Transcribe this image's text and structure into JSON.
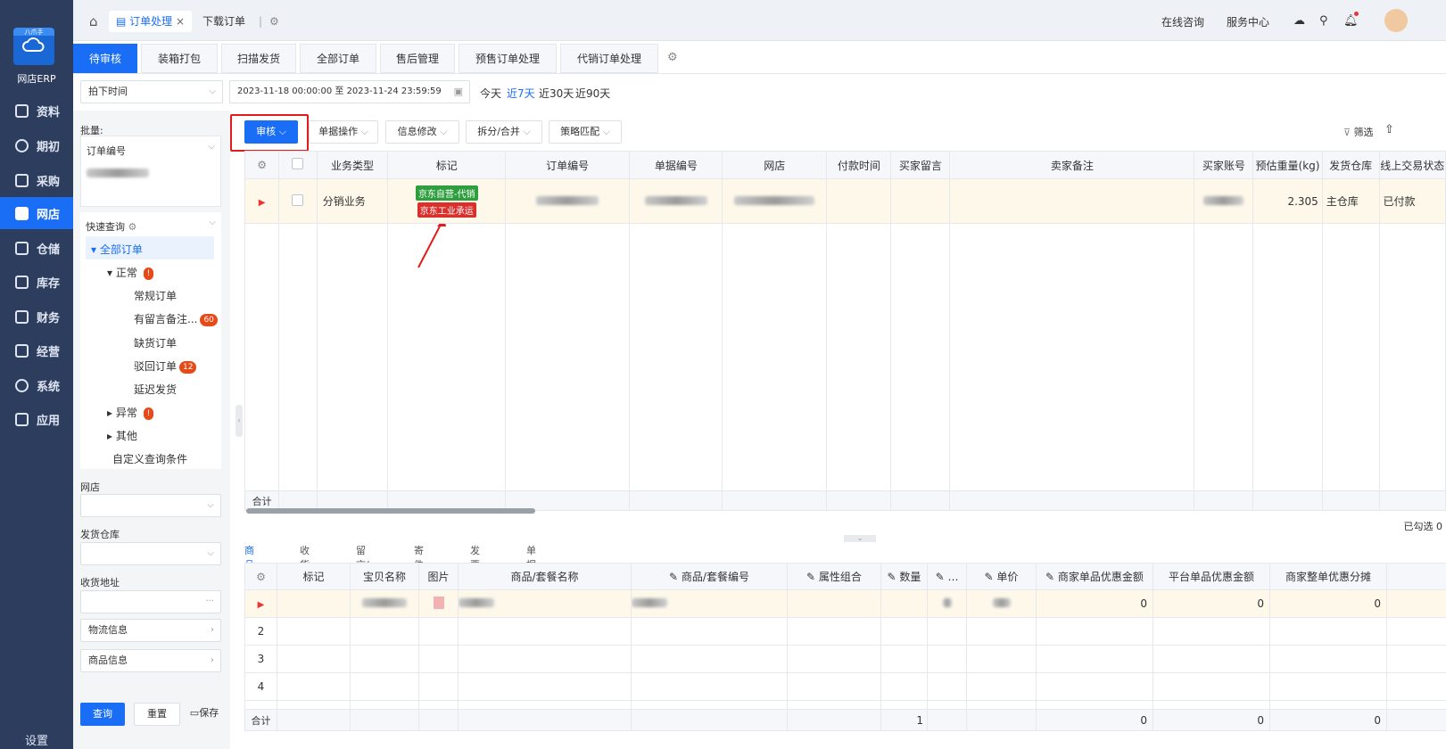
{
  "nav": {
    "logo_badge": "八爪手",
    "brand": "网店ERP",
    "items": [
      {
        "label": "资料",
        "icon": "doc-icon"
      },
      {
        "label": "期初",
        "icon": "target-icon"
      },
      {
        "label": "采购",
        "icon": "cart-icon"
      },
      {
        "label": "网店",
        "icon": "store-icon"
      },
      {
        "label": "仓储",
        "icon": "warehouse-icon"
      },
      {
        "label": "库存",
        "icon": "house-icon"
      },
      {
        "label": "财务",
        "icon": "finance-icon"
      },
      {
        "label": "经营",
        "icon": "chart-icon"
      },
      {
        "label": "系统",
        "icon": "system-icon"
      },
      {
        "label": "应用",
        "icon": "plus-icon"
      }
    ],
    "active_index": 3,
    "settings": "设置"
  },
  "topbar": {
    "tab_active": "订单处理",
    "tab_other": "下载订单",
    "online": "在线咨询",
    "service": "服务中心"
  },
  "tabs": [
    "待审核",
    "装箱打包",
    "扫描发货",
    "全部订单",
    "售后管理",
    "预售订单处理",
    "代销订单处理"
  ],
  "datebar": {
    "time_type": "拍下时间",
    "range": "2023-11-18 00:00:00  至  2023-11-24 23:59:59",
    "today": "今天",
    "d7": "近7天",
    "d30": "近30天",
    "d90": "近90天"
  },
  "left": {
    "batch": "批量:",
    "order_no": "订单编号",
    "quick": "快速查询",
    "all": "全部订单",
    "normal": "正常",
    "regular": "常规订单",
    "remark": "有留言备注...",
    "remark_count": "60",
    "shortage": "缺货订单",
    "rejected": "驳回订单",
    "rejected_count": "12",
    "delayed": "延迟发货",
    "abnormal": "异常",
    "other": "其他",
    "custom": "自定义查询条件",
    "shop": "网店",
    "warehouse": "发货仓库",
    "address": "收货地址",
    "logistics": "物流信息",
    "goods": "商品信息",
    "query": "查询",
    "reset": "重置",
    "save": "保存"
  },
  "toolbar": {
    "audit": "审核",
    "doc_ops": "单据操作",
    "info_edit": "信息修改",
    "split_merge": "拆分/合并",
    "strategy": "策略匹配",
    "filter": "筛选"
  },
  "orders": {
    "headers": [
      "业务类型",
      "标记",
      "订单编号",
      "单据编号",
      "网店",
      "付款时间",
      "买家留言",
      "卖家备注",
      "买家账号",
      "预估重量(kg)",
      "发货仓库",
      "线上交易状态"
    ],
    "row": {
      "type": "分销业务",
      "tag1": "京东自营-代销",
      "tag2": "京东工业承运",
      "weight": "2.305",
      "warehouse": "主仓库",
      "status": "已付款"
    },
    "total": "合计",
    "selected": "已勾选 0"
  },
  "detail": {
    "tabs": [
      "商品明细",
      "收货信息",
      "留言/备注",
      "寄件信息",
      "发票信息",
      "单据日志"
    ],
    "headers": [
      "标记",
      "宝贝名称",
      "图片",
      "商品/套餐名称",
      "商品/套餐编号",
      "属性组合",
      "数量",
      "…",
      "单价",
      "商家单品优惠金额",
      "平台单品优惠金额",
      "商家整单优惠分摊"
    ],
    "rows": [
      "2",
      "3",
      "4"
    ],
    "row1": {
      "v1": "0",
      "v2": "0",
      "v3": "0"
    },
    "total": "合计",
    "totals": {
      "qty": "1",
      "a": "0",
      "b": "0",
      "c": "0"
    }
  },
  "colors": {
    "primary": "#1a6ef5",
    "nav_bg": "#2d3d5e",
    "tag_green": "#2e9e3e",
    "tag_red": "#d9302c",
    "highlight": "#e31b1b"
  }
}
